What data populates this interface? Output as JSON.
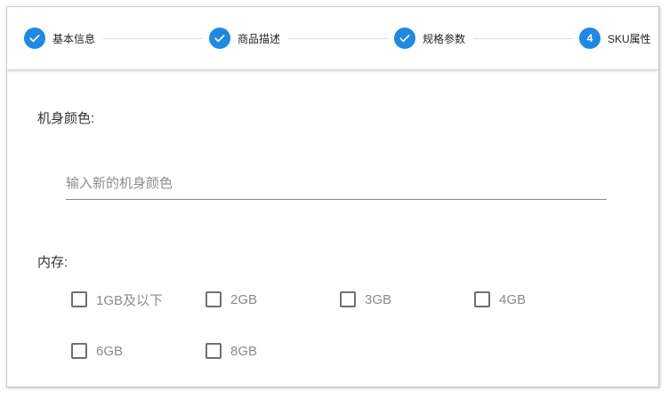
{
  "steps": [
    {
      "label": "基本信息",
      "state": "done",
      "icon": "check-icon"
    },
    {
      "label": "商品描述",
      "state": "done",
      "icon": "check-icon"
    },
    {
      "label": "规格参数",
      "state": "done",
      "icon": "check-icon"
    },
    {
      "label": "SKU属性",
      "state": "active",
      "number": "4"
    }
  ],
  "colors": {
    "accent": "#1e88e5",
    "divider": "#dcdcdc"
  },
  "color_section": {
    "label": "机身颜色:",
    "input_placeholder": "输入新的机身颜色",
    "input_value": ""
  },
  "memory_section": {
    "label": "内存:",
    "options": [
      {
        "label": "1GB及以下",
        "checked": false
      },
      {
        "label": "2GB",
        "checked": false
      },
      {
        "label": "3GB",
        "checked": false
      },
      {
        "label": "4GB",
        "checked": false
      },
      {
        "label": "6GB",
        "checked": false
      },
      {
        "label": "8GB",
        "checked": false
      }
    ]
  }
}
